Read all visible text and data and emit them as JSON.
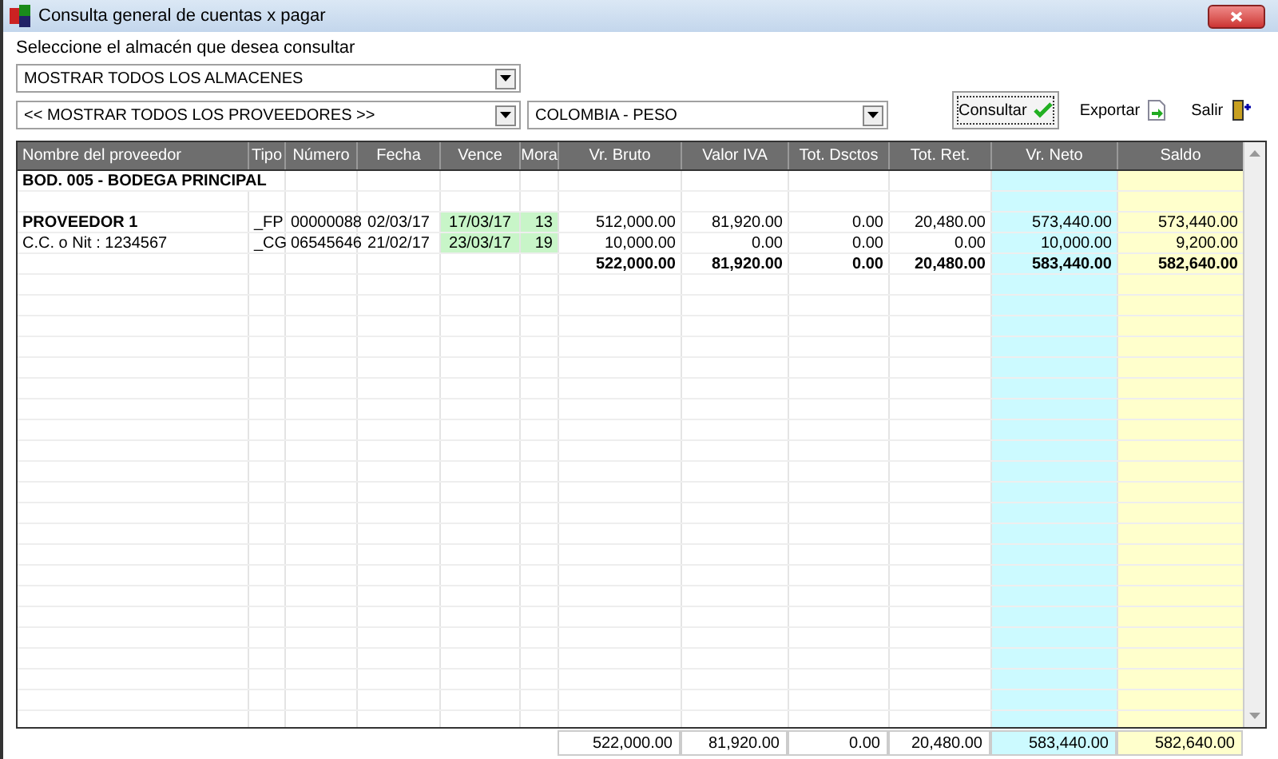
{
  "window": {
    "title": "Consulta general de cuentas x pagar"
  },
  "prompt": "Seleccione el almacén que desea consultar",
  "warehouse_select": {
    "value": "MOSTRAR TODOS LOS ALMACENES"
  },
  "supplier_select": {
    "value": "<< MOSTRAR TODOS LOS PROVEEDORES >>"
  },
  "currency_select": {
    "value": "COLOMBIA - PESO"
  },
  "buttons": [
    {
      "label": "Consultar",
      "kind": "check"
    },
    {
      "label": "Exportar",
      "kind": "export"
    },
    {
      "label": "Salir",
      "kind": "exit"
    }
  ],
  "table": {
    "columns": [
      {
        "label": "Nombre del proveedor"
      },
      {
        "label": "Tipo"
      },
      {
        "label": "Número"
      },
      {
        "label": "Fecha"
      },
      {
        "label": "Vence"
      },
      {
        "label": "Mora"
      },
      {
        "label": "Vr. Bruto"
      },
      {
        "label": "Valor IVA"
      },
      {
        "label": "Tot. Dsctos"
      },
      {
        "label": "Tot. Ret."
      },
      {
        "label": "Vr. Neto",
        "color": "#ccfaff"
      },
      {
        "label": "Saldo",
        "color": "#ffffcc"
      }
    ],
    "rows": [
      {
        "kind": "group",
        "label": "BOD. 005 - BODEGA PRINCIPAL"
      },
      {
        "kind": "blank"
      },
      {
        "kind": "provider",
        "cells": [
          "PROVEEDOR 1",
          "_FP",
          "00000088",
          "02/03/17",
          "17/03/17",
          "13",
          "512,000.00",
          "81,920.00",
          "0.00",
          "20,480.00",
          "573,440.00",
          "573,440.00"
        ]
      },
      {
        "kind": "detail",
        "cells": [
          "C.C. o Nit : 1234567",
          "_CG",
          "06545646",
          "21/02/17",
          "23/03/17",
          "19",
          "10,000.00",
          "0.00",
          "0.00",
          "0.00",
          "10,000.00",
          "9,200.00"
        ]
      },
      {
        "kind": "total",
        "values": [
          "522,000.00",
          "81,920.00",
          "0.00",
          "20,480.00",
          "583,440.00",
          "582,640.00"
        ]
      }
    ],
    "footer": [
      "522,000.00",
      "81,920.00",
      "0.00",
      "20,480.00",
      "583,440.00",
      "582,640.00"
    ]
  }
}
